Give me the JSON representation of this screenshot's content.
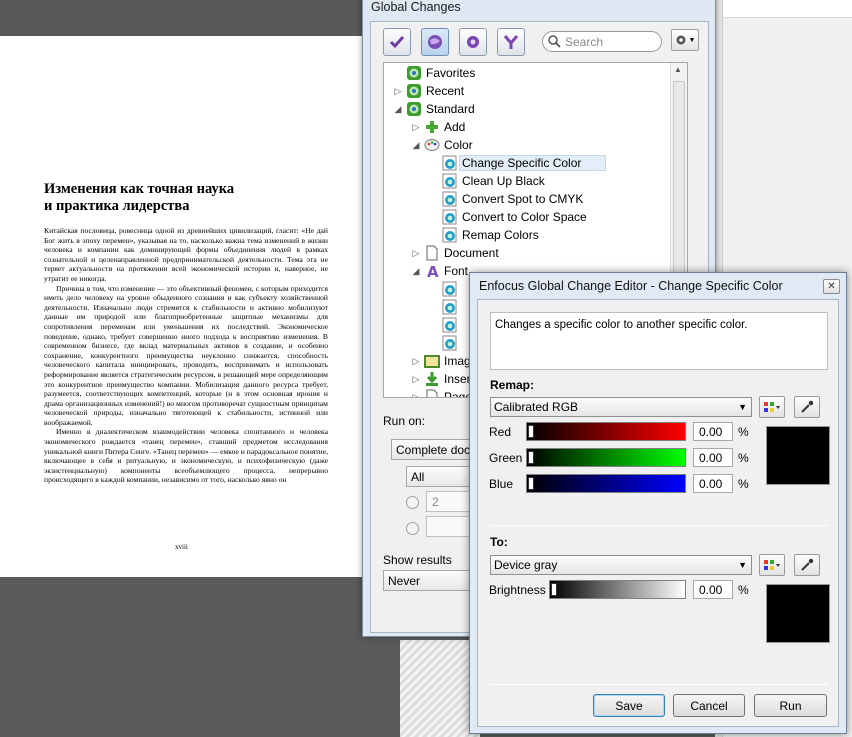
{
  "document": {
    "heading_line1": "Изменения как точная наука",
    "heading_line2": "и практика лидерства",
    "paragraphs": [
      "Китайская пословица, ровесница одной из древнейших цивилизаций, гласит: «Не дай Бог жить в эпоху перемен», указывая на то, насколько важна тема изменений в жизни человека и компании как доминирующей формы объединения людей в рамках сознательной и целенаправленной предпринимательской деятельности. Тема эта не теряет актуальности на протяжении всей экономической истории и, наверное, не утратит ее никогда.",
      "Причина в том, что изменение — это объективный феномен, с которым приходится иметь дело человеку на уровне обыденного сознания и как субъекту хозяйственной деятельности. Изначально люди стремятся к стабильности и активно мобилизуют данные им природой или благоприобретенные защитные механизмы для сопротивления переменам или уменьшения их последствий. Экономическое поведение, однако, требует совершенно иного подхода к восприятию изменения. В современном бизнесе, где вклад материальных активов в создание, и особенно сохранение, конкурентного преимущества неуклонно снижается, способность человеческого капитала инициировать, проводить, воспринимать и использовать реформирование является стратегическим ресурсом, в решающей мере определяющим это конкурентное преимущество компании. Мобилизация данного ресурса требует, разумеется, соответствующих компетенций, которые (и в этом основная ирония и драма организационных изменений!) во многом противоречат сущностным принципам человеческой природы, изначально тяготеющей к стабильности, истинной или воображаемой.",
      "Именно в диалектическом взаимодействии человека спонтанного и человека экономического рождается «танец перемен», ставший предметом исследования уникальной книги Питера Сенге. «Танец перемен» — емкое и парадоксальное понятие, включающее в себя и ритуальную, и экономическую, и психофизическую (даже экзистенциальную) компоненты всеобъемлющего процесса, непрерывно происходящего в каждой компании, независимо от того, насколько явно он"
    ],
    "page_number": "xviii"
  },
  "global_changes": {
    "title": "Global Changes",
    "search_placeholder": "Search",
    "tree": [
      {
        "label": "Favorites",
        "level": 0,
        "exp": "",
        "icon": "globe"
      },
      {
        "label": "Recent",
        "level": 0,
        "exp": "▷",
        "icon": "globe"
      },
      {
        "label": "Standard",
        "level": 0,
        "exp": "◢",
        "icon": "globe"
      },
      {
        "label": "Add",
        "level": 1,
        "exp": "▷",
        "icon": "plus"
      },
      {
        "label": "Color",
        "level": 1,
        "exp": "◢",
        "icon": "palette"
      },
      {
        "label": "Change Specific Color",
        "level": 2,
        "exp": "",
        "icon": "action",
        "selected": true
      },
      {
        "label": "Clean Up Black",
        "level": 2,
        "exp": "",
        "icon": "action"
      },
      {
        "label": "Convert Spot to CMYK",
        "level": 2,
        "exp": "",
        "icon": "action"
      },
      {
        "label": "Convert to Color Space",
        "level": 2,
        "exp": "",
        "icon": "action"
      },
      {
        "label": "Remap Colors",
        "level": 2,
        "exp": "",
        "icon": "action"
      },
      {
        "label": "Document",
        "level": 1,
        "exp": "▷",
        "icon": "doc"
      },
      {
        "label": "Font",
        "level": 1,
        "exp": "◢",
        "icon": "font"
      },
      {
        "label": "",
        "level": 2,
        "exp": "",
        "icon": "action"
      },
      {
        "label": "",
        "level": 2,
        "exp": "",
        "icon": "action"
      },
      {
        "label": "",
        "level": 2,
        "exp": "",
        "icon": "action"
      },
      {
        "label": "",
        "level": 2,
        "exp": "",
        "icon": "action"
      },
      {
        "label": "Imag",
        "level": 1,
        "exp": "▷",
        "icon": "image"
      },
      {
        "label": "Inser",
        "level": 1,
        "exp": "▷",
        "icon": "insert"
      },
      {
        "label": "Page",
        "level": 1,
        "exp": "▷",
        "icon": "doc"
      }
    ],
    "run_on_label": "Run on:",
    "run_on_value": "Complete docum",
    "all_value": "All",
    "page_value": "2",
    "show_results_label": "Show results",
    "show_results_value": "Never"
  },
  "editor": {
    "title": "Enfocus Global Change Editor - Change Specific Color",
    "description": "Changes a specific color to another specific color.",
    "remap_label": "Remap:",
    "remap_space": "Calibrated RGB",
    "channels": [
      {
        "name": "Red",
        "value": "0.00",
        "unit": "%",
        "color": "#ff0000"
      },
      {
        "name": "Green",
        "value": "0.00",
        "unit": "%",
        "color": "#00ff00"
      },
      {
        "name": "Blue",
        "value": "0.00",
        "unit": "%",
        "color": "#0000ff"
      }
    ],
    "to_label": "To:",
    "to_space": "Device gray",
    "brightness": {
      "name": "Brightness",
      "value": "0.00",
      "unit": "%"
    },
    "buttons": {
      "save": "Save",
      "cancel": "Cancel",
      "run": "Run"
    }
  }
}
